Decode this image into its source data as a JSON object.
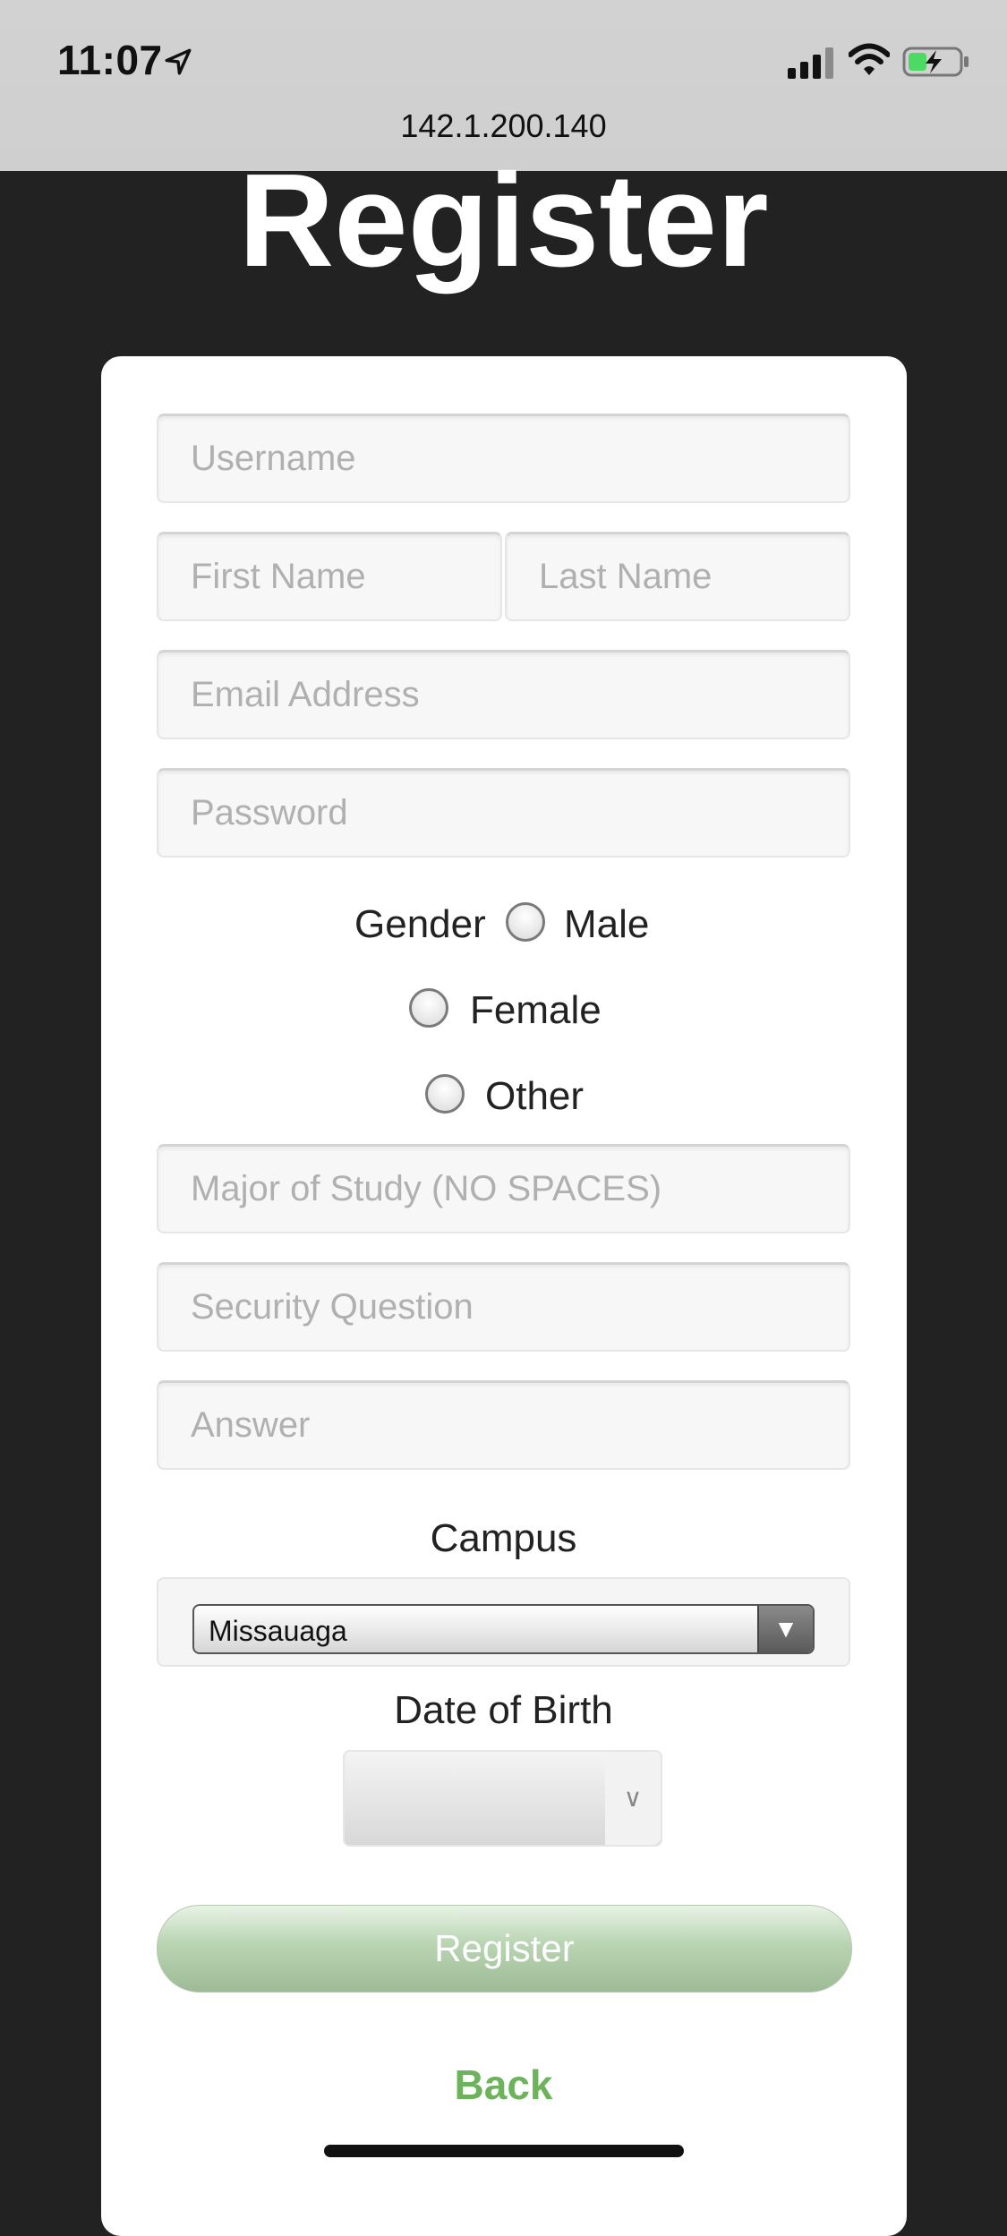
{
  "status_bar": {
    "time": "11:07",
    "url": "142.1.200.140"
  },
  "page": {
    "title": "Register"
  },
  "form": {
    "username_placeholder": "Username",
    "first_name_placeholder": "First Name",
    "last_name_placeholder": "Last Name",
    "email_placeholder": "Email Address",
    "password_placeholder": "Password",
    "gender_label": "Gender",
    "gender_options": [
      "Male",
      "Female",
      "Other"
    ],
    "major_placeholder": "Major of Study (NO SPACES)",
    "security_question_placeholder": "Security Question",
    "answer_placeholder": "Answer",
    "campus_label": "Campus",
    "campus_selected": "Missauaga",
    "dob_label": "Date of Birth",
    "dob_value": "",
    "register_label": "Register",
    "back_label": "Back"
  },
  "colors": {
    "background": "#222222",
    "accent_green": "#6db35b"
  },
  "icons": {
    "location": "location-arrow-icon",
    "signal": "cellular-signal-icon",
    "wifi": "wifi-icon",
    "battery": "battery-charging-icon"
  }
}
